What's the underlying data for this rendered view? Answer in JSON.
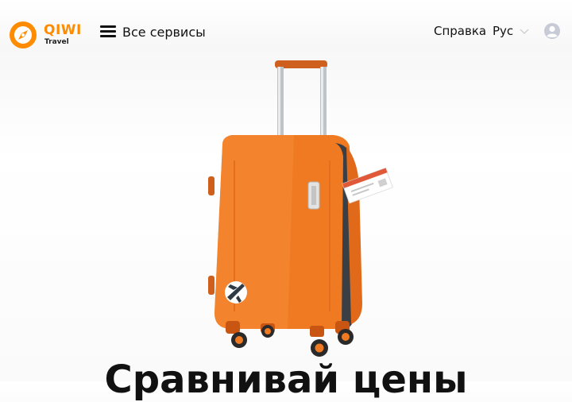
{
  "header": {
    "logo": {
      "brand": "QIWI",
      "sub": "Travel",
      "color": "#ff8c00"
    },
    "services_label": "Все сервисы",
    "help_label": "Справка",
    "lang_label": "Рус"
  },
  "hero": {
    "headline": "Сравнивай цены",
    "image": "orange-suitcase-with-airplane-sticker-and-ticket"
  },
  "colors": {
    "accent": "#ff8c00",
    "suitcase": "#f07a22"
  }
}
